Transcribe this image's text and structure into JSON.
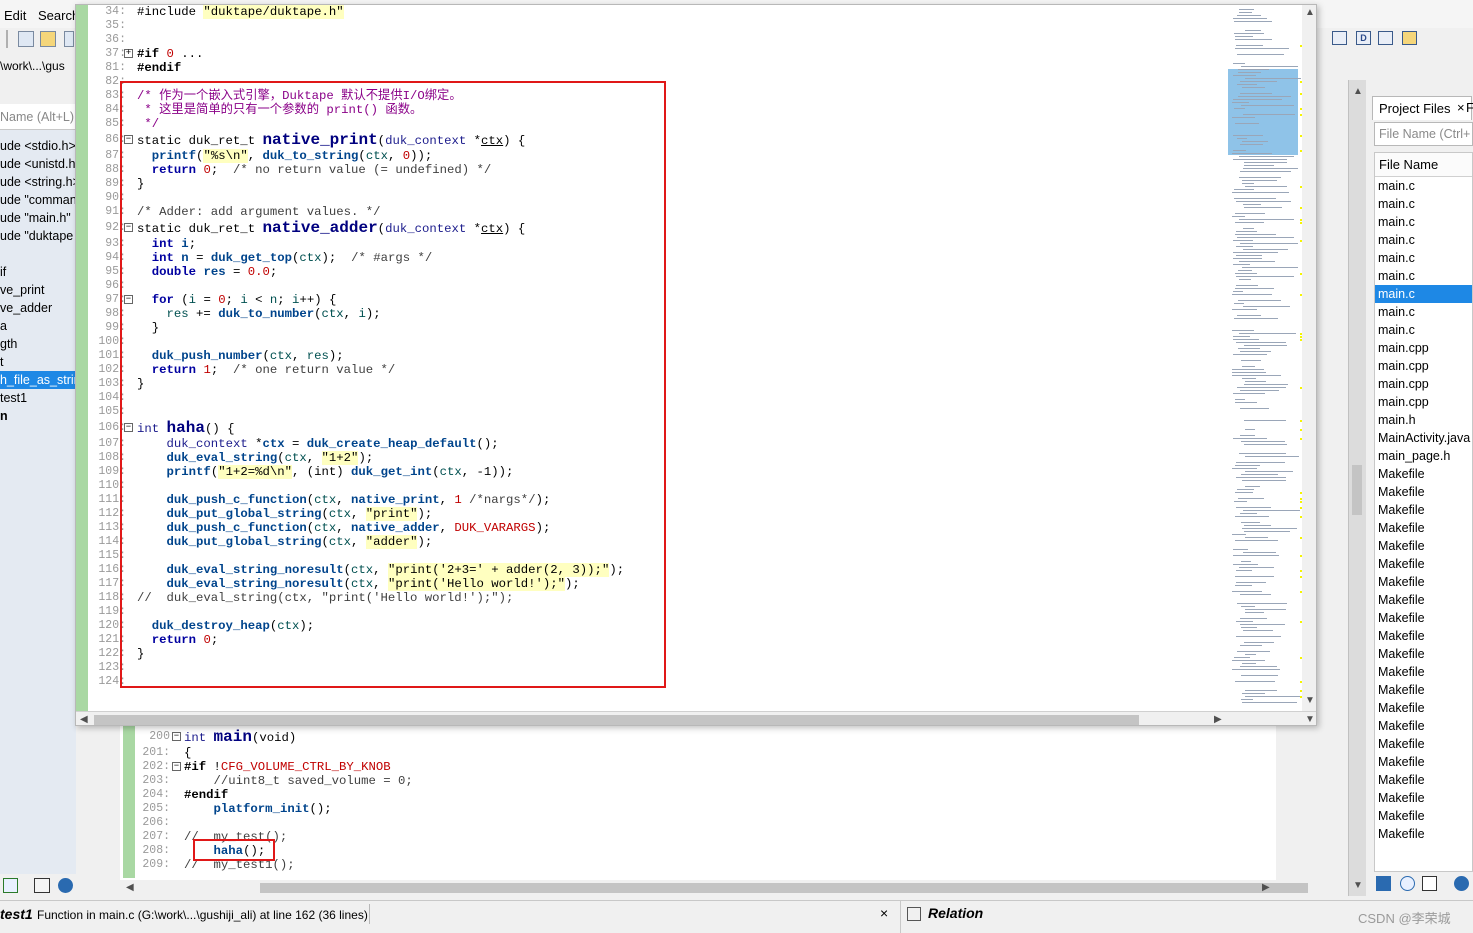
{
  "menu": {
    "edit": "Edit",
    "search": "Search"
  },
  "path": "\\work\\...\\gus",
  "symbols": {
    "placeholder": "Name (Alt+L)",
    "items": [
      "ude <stdio.h>",
      "ude <unistd.h>",
      "ude <string.h>",
      "ude \"comman",
      "ude \"main.h\"",
      "ude \"duktape",
      "",
      "if",
      "ve_print",
      "ve_adder",
      "a",
      "gth",
      "t",
      "h_file_as_strin",
      "test1",
      "n"
    ]
  },
  "popup_lines": [
    {
      "n": "34:",
      "html": "#include <span class=\"str\">\"duktape/duktape.h\"</span>"
    },
    {
      "n": "35:",
      "html": ""
    },
    {
      "n": "36:",
      "html": ""
    },
    {
      "n": "37:",
      "html": "<span class=\"pp\">#if</span> <span class=\"num\">0</span> ...",
      "fold": "+"
    },
    {
      "n": "81:",
      "html": "<span class=\"pp\">#endif</span>"
    },
    {
      "n": "82:",
      "html": ""
    },
    {
      "n": "83:",
      "html": "<span class=\"cmzh\">/* 作为一个嵌入式引擎，Duktape 默认不提供I/O绑定。</span>"
    },
    {
      "n": "84:",
      "html": "<span class=\"cmzh\"> * 这里是简单的只有一个参数的 print() 函数。</span>"
    },
    {
      "n": "85:",
      "html": "<span class=\"cmzh\"> */</span>"
    },
    {
      "n": "86:",
      "html": "static duk_ret_t <span class=\"big\">native_print</span>(<span class=\"ty\">duk_context</span> *<span class=\"u\">ctx</span>) {",
      "fold": "-",
      "big": true
    },
    {
      "n": "87:",
      "html": "  <span class=\"fn\">printf</span>(<span class=\"str\">\"%s\\n\"</span>, <span class=\"fn\">duk_to_string</span>(<span class=\"var\">ctx</span>, <span class=\"num\">0</span>));"
    },
    {
      "n": "88:",
      "html": "  <span class=\"kw\">return</span> <span class=\"num\">0</span>;  <span class=\"cm\">/* no return value (= undefined) */</span>"
    },
    {
      "n": "89:",
      "html": "}"
    },
    {
      "n": "90:",
      "html": ""
    },
    {
      "n": "91:",
      "html": "<span class=\"cm\">/* Adder: add argument values. */</span>"
    },
    {
      "n": "92:",
      "html": "static duk_ret_t <span class=\"big\">native_adder</span>(<span class=\"ty\">duk_context</span> *<span class=\"u\">ctx</span>) {",
      "fold": "-",
      "big": true
    },
    {
      "n": "93:",
      "html": "  <span class=\"kw\">int</span> <span class=\"fn\">i</span>;"
    },
    {
      "n": "94:",
      "html": "  <span class=\"kw\">int</span> <span class=\"fn\">n</span> = <span class=\"fn\">duk_get_top</span>(<span class=\"var\">ctx</span>);  <span class=\"cm\">/* #args */</span>"
    },
    {
      "n": "95:",
      "html": "  <span class=\"kw\">double</span> <span class=\"fn\">res</span> = <span class=\"num\">0.0</span>;"
    },
    {
      "n": "96:",
      "html": ""
    },
    {
      "n": "97:",
      "html": "  <span class=\"kw\">for</span> (<span class=\"var\">i</span> = <span class=\"num\">0</span>; <span class=\"var\">i</span> &lt; <span class=\"var\">n</span>; <span class=\"var\">i</span>++) {",
      "fold": "-"
    },
    {
      "n": "98:",
      "html": "    <span class=\"var\">res</span> += <span class=\"fn\">duk_to_number</span>(<span class=\"var\">ctx</span>, <span class=\"var\">i</span>);"
    },
    {
      "n": "99:",
      "html": "  }"
    },
    {
      "n": "100:",
      "html": ""
    },
    {
      "n": "101:",
      "html": "  <span class=\"fn\">duk_push_number</span>(<span class=\"var\">ctx</span>, <span class=\"var\">res</span>);"
    },
    {
      "n": "102:",
      "html": "  <span class=\"kw\">return</span> <span class=\"num\">1</span>;  <span class=\"cm\">/* one return value */</span>"
    },
    {
      "n": "103:",
      "html": "}"
    },
    {
      "n": "104:",
      "html": ""
    },
    {
      "n": "105:",
      "html": ""
    },
    {
      "n": "106:",
      "html": "<span class=\"ty\">int</span> <span class=\"big\">haha</span>() {",
      "fold": "-",
      "big": true
    },
    {
      "n": "107:",
      "html": "    <span class=\"ty\">duk_context</span> *<span class=\"fn\">ctx</span> = <span class=\"fn\">duk_create_heap_default</span>();"
    },
    {
      "n": "108:",
      "html": "    <span class=\"fn\">duk_eval_string</span>(<span class=\"var\">ctx</span>, <span class=\"str\">\"1+2\"</span>);"
    },
    {
      "n": "109:",
      "html": "    <span class=\"fn\">printf</span>(<span class=\"str\">\"1+2=%d\\n\"</span>, (int) <span class=\"fn\">duk_get_int</span>(<span class=\"var\">ctx</span>, -1));"
    },
    {
      "n": "110:",
      "html": ""
    },
    {
      "n": "111:",
      "html": "    <span class=\"fn\">duk_push_c_function</span>(<span class=\"var\">ctx</span>, <span class=\"fn\">native_print</span>, <span class=\"num\">1</span> <span class=\"cm\">/*nargs*/</span>);"
    },
    {
      "n": "112:",
      "html": "    <span class=\"fn\">duk_put_global_string</span>(<span class=\"var\">ctx</span>, <span class=\"str\">\"print\"</span>);"
    },
    {
      "n": "113:",
      "html": "    <span class=\"fn\">duk_push_c_function</span>(<span class=\"var\">ctx</span>, <span class=\"fn\">native_adder</span>, <span class=\"mac\">DUK_VARARGS</span>);"
    },
    {
      "n": "114:",
      "html": "    <span class=\"fn\">duk_put_global_string</span>(<span class=\"var\">ctx</span>, <span class=\"str\">\"adder\"</span>);"
    },
    {
      "n": "115:",
      "html": ""
    },
    {
      "n": "116:",
      "html": "    <span class=\"fn\">duk_eval_string_noresult</span>(<span class=\"var\">ctx</span>, <span class=\"str\">\"print('2+3=' + adder(2, 3));\"</span>);"
    },
    {
      "n": "117:",
      "html": "    <span class=\"fn\">duk_eval_string_noresult</span>(<span class=\"var\">ctx</span>, <span class=\"str\">\"print('Hello world!');\"</span>);"
    },
    {
      "n": "118:",
      "html": "<span class=\"cm\">//  duk_eval_string(ctx, \"print('Hello world!');\");</span>"
    },
    {
      "n": "119:",
      "html": ""
    },
    {
      "n": "120:",
      "html": "  <span class=\"fn\">duk_destroy_heap</span>(<span class=\"var\">ctx</span>);"
    },
    {
      "n": "121:",
      "html": "  <span class=\"kw\">return</span> <span class=\"num\">0</span>;"
    },
    {
      "n": "122:",
      "html": "}"
    },
    {
      "n": "123:",
      "html": ""
    },
    {
      "n": "124:",
      "html": ""
    }
  ],
  "bg_lines": [
    {
      "n": "200",
      "html": "<span class=\"ty\">int</span> <span class=\"big\">main</span>(void)",
      "fold": "-"
    },
    {
      "n": "201:",
      "html": "{"
    },
    {
      "n": "202:",
      "html": "<span class=\"pp\">#if</span> !<span class=\"mac\">CFG_VOLUME_CTRL_BY_KNOB</span>",
      "fold": "-"
    },
    {
      "n": "203:",
      "html": "    <span class=\"cm\">//uint8_t saved_volume = 0;</span>"
    },
    {
      "n": "204:",
      "html": "<span class=\"pp\">#endif</span>"
    },
    {
      "n": "205:",
      "html": "    <span class=\"fn\">platform_init</span>();"
    },
    {
      "n": "206:",
      "html": ""
    },
    {
      "n": "207:",
      "html": "<span class=\"cm\">//  my_test();</span>"
    },
    {
      "n": "208:",
      "html": "    <span class=\"fn\">haha</span>();"
    },
    {
      "n": "209:",
      "html": "<span class=\"cm\">//  my_test1();</span>"
    }
  ],
  "project": {
    "tab": "Project Files",
    "tab2": "F",
    "filter_placeholder": "File Name (Ctrl+",
    "column": "File Name",
    "files": [
      "main.c",
      "main.c",
      "main.c",
      "main.c",
      "main.c",
      "main.c",
      "main.c",
      "main.c",
      "main.c",
      "main.cpp",
      "main.cpp",
      "main.cpp",
      "main.cpp",
      "main.h",
      "MainActivity.java",
      "main_page.h",
      "Makefile",
      "Makefile",
      "Makefile",
      "Makefile",
      "Makefile",
      "Makefile",
      "Makefile",
      "Makefile",
      "Makefile",
      "Makefile",
      "Makefile",
      "Makefile",
      "Makefile",
      "Makefile",
      "Makefile",
      "Makefile",
      "Makefile",
      "Makefile",
      "Makefile",
      "Makefile",
      "Makefile"
    ],
    "selected_index": 6
  },
  "status": {
    "symbol": "test1",
    "text": "Function in main.c (G:\\work\\...\\gushiji_ali) at line 162 (36 lines)",
    "close": "×"
  },
  "relation": {
    "title": "Relation"
  },
  "watermark": "CSDN @李荣城"
}
